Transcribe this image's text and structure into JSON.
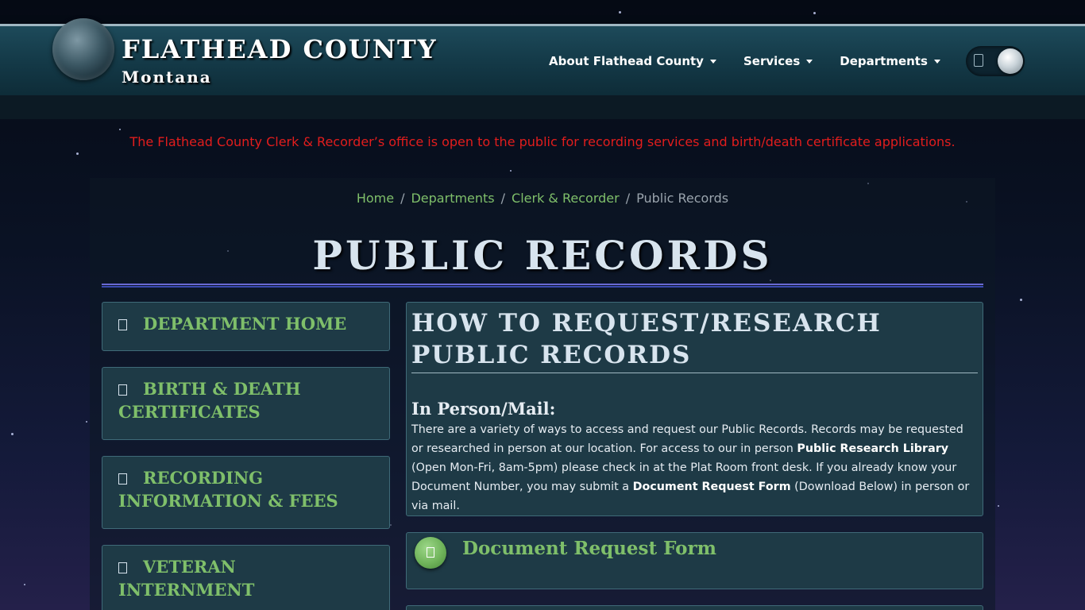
{
  "header": {
    "title": "FLATHEAD COUNTY",
    "subtitle": "Montana",
    "nav": [
      {
        "label": "About Flathead County"
      },
      {
        "label": "Services"
      },
      {
        "label": "Departments"
      }
    ]
  },
  "alert": "The Flathead County Clerk & Recorder’s office is open to the public for recording services and birth/death certificate applications.",
  "breadcrumb": {
    "items": [
      "Home",
      "Departments",
      "Clerk & Recorder"
    ],
    "current": "Public Records"
  },
  "page_title": "PUBLIC RECORDS",
  "sidebar": {
    "items": [
      {
        "label": "DEPARTMENT HOME"
      },
      {
        "label": "BIRTH & DEATH CERTIFICATES"
      },
      {
        "label": "RECORDING INFORMATION & FEES"
      },
      {
        "label": "VETERAN INTERNMENT"
      }
    ]
  },
  "main": {
    "heading": "HOW TO REQUEST/RESEARCH PUBLIC RECORDS",
    "subheading": "In Person/Mail:",
    "text_1": "There are a variety of ways to access and request our Public Records. Records may be requested or researched in person at our location. For access to our in person ",
    "bold_1": "Public Research Library",
    "text_2": " (Open Mon-Fri, 8am-5pm) please check in at the Plat Room front desk. If you already know your Document Number, you may submit a ",
    "bold_2": "Document Request Form",
    "text_3": " (Download Below) in person or via mail."
  },
  "document": {
    "title": "Document Request Form"
  },
  "colors": {
    "accent_green": "#7fbf6a",
    "alert_red": "#e21d1d",
    "header_teal": "#1d4a5a"
  }
}
